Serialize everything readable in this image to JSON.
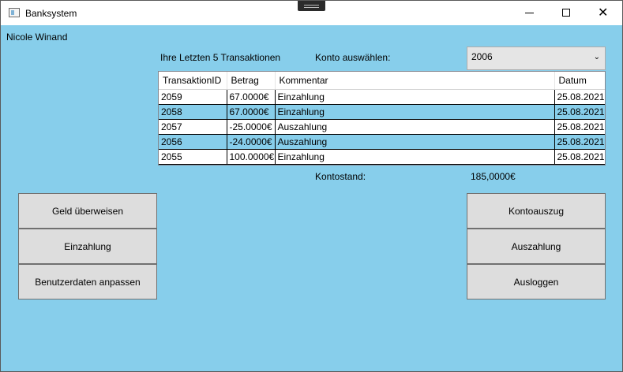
{
  "window": {
    "title": "Banksystem",
    "close_glyph": "✕"
  },
  "user": {
    "name": "Nicole Winand"
  },
  "labels": {
    "last_transactions": "Ihre Letzten 5 Transaktionen",
    "select_account": "Konto auswählen:",
    "balance_label": "Kontostand:",
    "balance_value": "185,0000€"
  },
  "account_select": {
    "value": "2006",
    "arrow": "⌄"
  },
  "table": {
    "headers": [
      "TransaktionID",
      "Betrag",
      "Kommentar",
      "Datum"
    ],
    "rows": [
      [
        "2059",
        "67.0000€",
        "Einzahlung",
        "25.08.2021"
      ],
      [
        "2058",
        "67.0000€",
        "Einzahlung",
        "25.08.2021"
      ],
      [
        "2057",
        "-25.0000€",
        "Auszahlung",
        "25.08.2021"
      ],
      [
        "2056",
        "-24.0000€",
        "Auszahlung",
        "25.08.2021"
      ],
      [
        "2055",
        "100.0000€",
        "Einzahlung",
        "25.08.2021"
      ]
    ]
  },
  "buttons": {
    "transfer": "Geld überweisen",
    "deposit": "Einzahlung",
    "edit_user": "Benutzerdaten anpassen",
    "statement": "Kontoauszug",
    "withdraw": "Auszahlung",
    "logout": "Ausloggen"
  },
  "colors": {
    "background": "#87ceeb",
    "button": "#dddddd",
    "alt_row": "#87ceeb"
  }
}
